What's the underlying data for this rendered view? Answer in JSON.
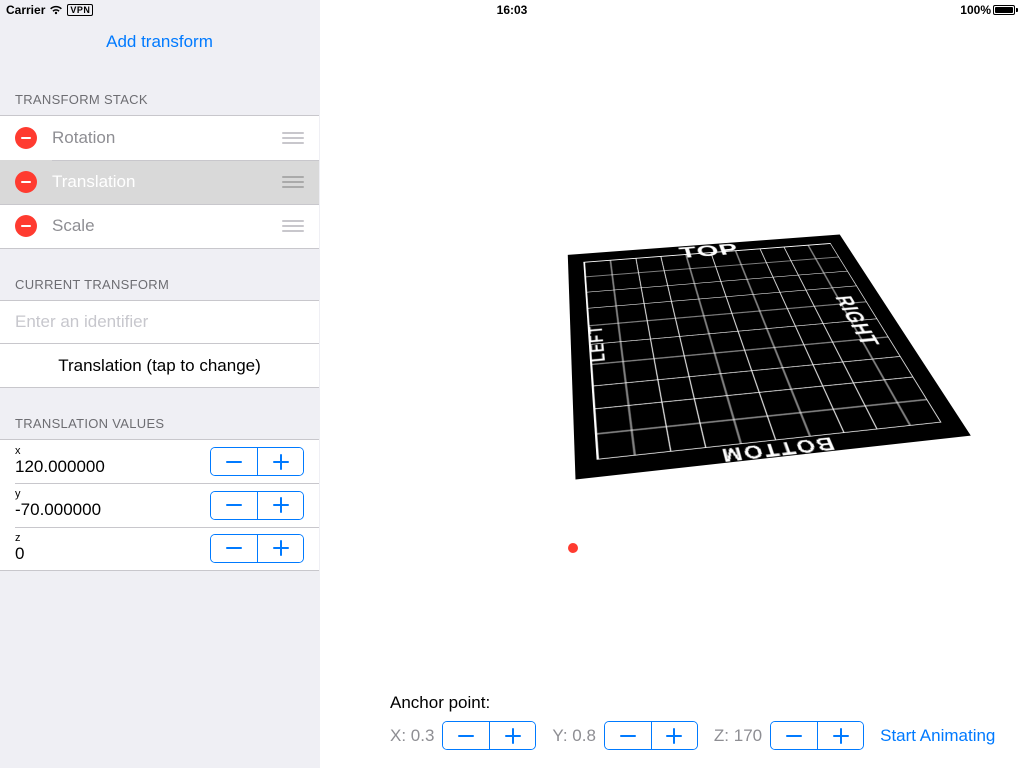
{
  "status": {
    "carrier": "Carrier",
    "vpn": "VPN",
    "time": "16:03",
    "battery": "100%"
  },
  "sidebar": {
    "add_label": "Add transform",
    "stack_header": "TRANSFORM STACK",
    "items": [
      {
        "label": "Rotation",
        "selected": false
      },
      {
        "label": "Translation",
        "selected": true
      },
      {
        "label": "Scale",
        "selected": false
      }
    ],
    "current_header": "CURRENT TRANSFORM",
    "identifier_placeholder": "Enter an identifier",
    "type_label": "Translation (tap to change)",
    "values_header": "TRANSLATION VALUES",
    "values": [
      {
        "axis": "x",
        "value": "120.000000"
      },
      {
        "axis": "y",
        "value": "-70.000000"
      },
      {
        "axis": "z",
        "value": "0"
      }
    ]
  },
  "preview": {
    "edges": {
      "top": "TOP",
      "bottom": "BOTTOM",
      "left": "LEFT",
      "right": "RIGHT"
    }
  },
  "bottom": {
    "anchor_title": "Anchor point:",
    "x_label": "X: 0.3",
    "y_label": "Y: 0.8",
    "z_label": "Z: 170",
    "start_label": "Start Animating"
  }
}
